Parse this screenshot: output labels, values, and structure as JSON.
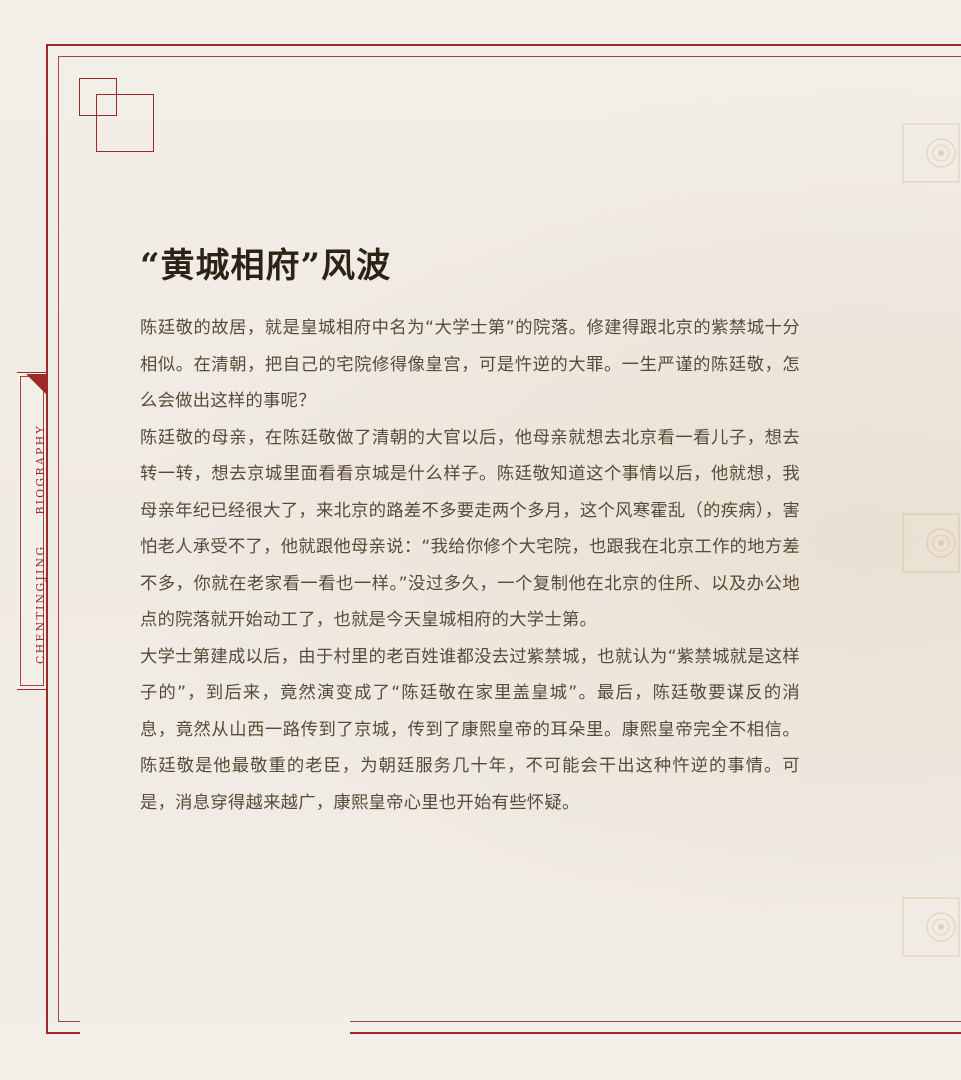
{
  "side_label": {
    "left": "CHENTINGJING",
    "right": "BIOGRAPHY"
  },
  "article": {
    "title": "“黄城相府”风波",
    "paragraphs": [
      "陈廷敬的故居，就是皇城相府中名为“大学士第”的院落。修建得跟北京的紫禁城十分相似。在清朝，把自己的宅院修得像皇宫，可是忤逆的大罪。一生严谨的陈廷敬，怎么会做出这样的事呢？",
      "陈廷敬的母亲，在陈廷敬做了清朝的大官以后，他母亲就想去北京看一看儿子，想去转一转，想去京城里面看看京城是什么样子。陈廷敬知道这个事情以后，他就想，我母亲年纪已经很大了，来北京的路差不多要走两个多月，这个风寒霍乱（的疾病），害怕老人承受不了，他就跟他母亲说：“我给你修个大宅院，也跟我在北京工作的地方差不多，你就在老家看一看也一样。”没过多久，一个复制他在北京的住所、以及办公地点的院落就开始动工了，也就是今天皇城相府的大学士第。",
      "大学士第建成以后，由于村里的老百姓谁都没去过紫禁城，也就认为“紫禁城就是这样子的”，到后来，竟然演变成了“陈廷敬在家里盖皇城”。最后，陈廷敬要谋反的消息，竟然从山西一路传到了京城，传到了康熙皇帝的耳朵里。康熙皇帝完全不相信。陈廷敬是他最敬重的老臣，为朝廷服务几十年，不可能会干出这种忤逆的事情。可是，消息穿得越来越广，康熙皇帝心里也开始有些怀疑。"
    ]
  },
  "colors": {
    "frame": "#9b2a2a",
    "title": "#2e2217",
    "body": "#5a4a38",
    "paper": "#f1ede6"
  }
}
